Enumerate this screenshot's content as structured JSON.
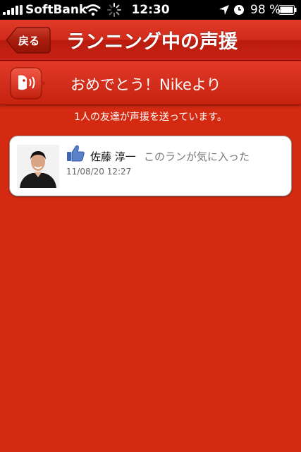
{
  "status_bar": {
    "carrier": "SoftBank",
    "time": "12:30",
    "battery_percent": "98 %"
  },
  "navbar": {
    "back_label": "戻る",
    "title": "ランニング中の声援"
  },
  "banner": {
    "text": "おめでとう！Nikeより"
  },
  "friends_count_text": "1人の友達が声援を送っています。",
  "cheers": [
    {
      "name": "佐藤 淳一",
      "message": "このランが気に入った",
      "timestamp": "11/08/20 12:27",
      "icon": "thumbs-up-icon"
    }
  ],
  "colors": {
    "background_red": "#d42a12",
    "nav_red": "#d12a1a",
    "like_blue": "#3d66b3"
  }
}
